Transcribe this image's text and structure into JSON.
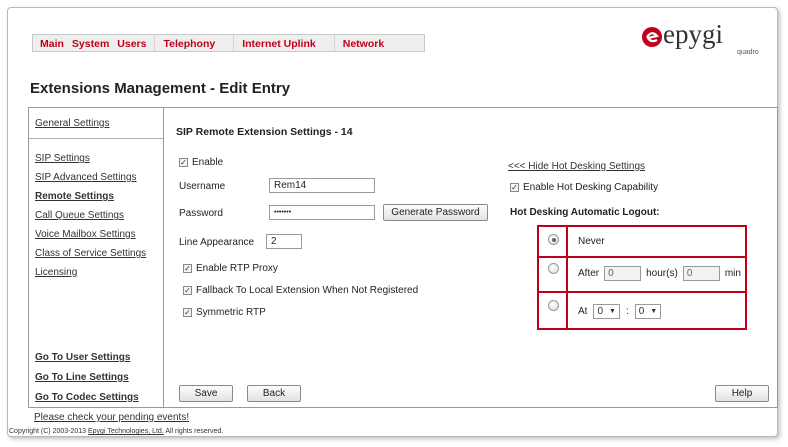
{
  "menu": {
    "items": [
      "Main",
      "System",
      "Users",
      "Telephony",
      "Internet Uplink",
      "Network"
    ]
  },
  "logo": {
    "name": "epygi",
    "sub": "quadro"
  },
  "page_title": "Extensions Management - Edit Entry",
  "sidebar": {
    "general": "General Settings",
    "sip": "SIP Settings",
    "sip_advanced": "SIP Advanced Settings",
    "remote": "Remote Settings",
    "call_queue": "Call Queue Settings",
    "voice_mailbox": "Voice Mailbox Settings",
    "class_of_service": "Class of Service Settings",
    "licensing": "Licensing",
    "go_user": "Go To User Settings",
    "go_line": "Go To Line Settings",
    "go_codec": "Go To Codec Settings"
  },
  "content": {
    "section_title": "SIP Remote Extension Settings - 14",
    "enable_label": "Enable",
    "username_label": "Username",
    "username_value": "Rem14",
    "password_label": "Password",
    "password_value": "•••••••",
    "generate_password": "Generate Password",
    "line_appearance_label": "Line Appearance",
    "line_appearance_value": "2",
    "enable_rtp_proxy": "Enable RTP Proxy",
    "fallback": "Fallback To Local Extension When Not Registered",
    "symmetric_rtp": "Symmetric RTP",
    "save": "Save",
    "back": "Back",
    "help": "Help"
  },
  "hot_desking": {
    "hide_link": "<<< Hide Hot Desking Settings",
    "enable_capability": "Enable Hot Desking Capability",
    "logout_title": "Hot Desking Automatic Logout:",
    "never": "Never",
    "after": "After",
    "hours_value": "0",
    "hours_unit": "hour(s)",
    "min_value": "0",
    "min_unit": "min",
    "at": "At",
    "at_hour": "0",
    "at_sep": ":",
    "at_min": "0",
    "dropdown_arrow": "▼",
    "check": "✓"
  },
  "footer": {
    "pending": "Please check your pending events!",
    "copyright_prefix": "Copyright (C) 2003-2013 ",
    "copyright_company": "Epygi Technologies, Ltd.",
    "copyright_suffix": " All rights reserved."
  },
  "colors": {
    "menu_text": "#c0001b",
    "option_border": "#c00019",
    "logo_mark": "#c0001b"
  }
}
